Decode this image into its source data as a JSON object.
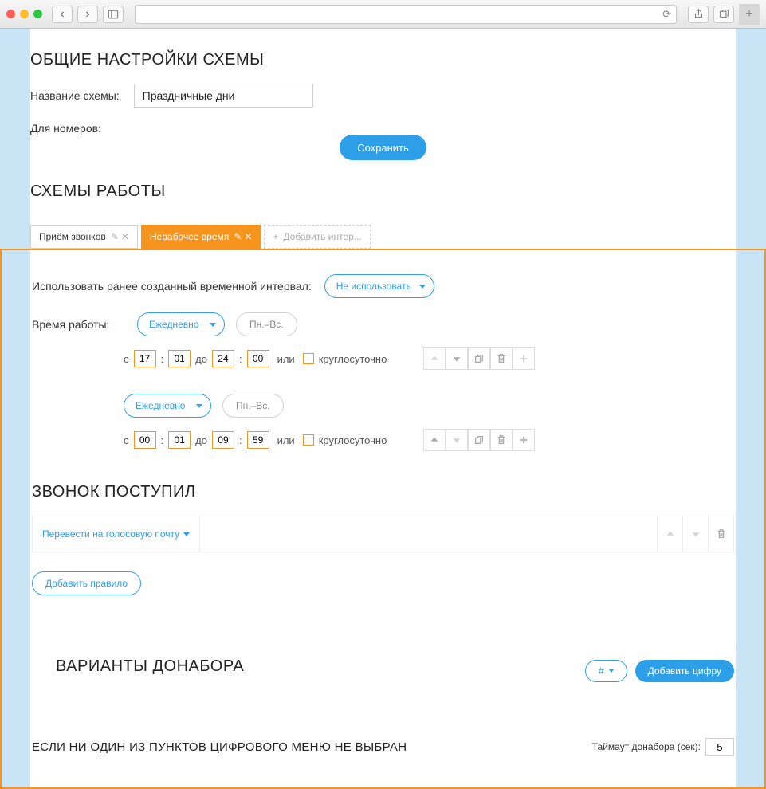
{
  "browser": {},
  "general": {
    "heading": "ОБЩИЕ НАСТРОЙКИ СХЕМЫ",
    "name_label": "Название схемы:",
    "name_value": "Праздничные дни",
    "numbers_label": "Для номеров:",
    "save": "Сохранить"
  },
  "schemes": {
    "heading": "СХЕМЫ РАБОТЫ",
    "tabs": [
      {
        "label": "Приём звонков"
      },
      {
        "label": "Нерабочее время"
      },
      {
        "label": "Добавить интер..."
      }
    ]
  },
  "work": {
    "interval_label": "Использовать ранее созданный временной интервал:",
    "interval_select": "Не использовать",
    "time_label": "Время работы:",
    "freq": "Ежедневно",
    "days": "Пн.–Вс.",
    "from": "с",
    "sep": ":",
    "to": "до",
    "or": "или",
    "allday": "круглосуточно",
    "rows": [
      {
        "h1": "17",
        "m1": "01",
        "h2": "24",
        "m2": "00"
      },
      {
        "h1": "00",
        "m1": "01",
        "h2": "09",
        "m2": "59"
      }
    ]
  },
  "call": {
    "heading": "ЗВОНОК ПОСТУПИЛ",
    "rule_select": "Перевести на голосовую почту",
    "add_rule": "Добавить правило"
  },
  "dial": {
    "heading": "ВАРИАНТЫ ДОНАБОРА",
    "hash": "#",
    "add": "Добавить цифру"
  },
  "fallback": {
    "heading": "ЕСЛИ НИ ОДИН ИЗ ПУНКТОВ ЦИФРОВОГО МЕНЮ НЕ ВЫБРАН",
    "timeout_label": "Таймаут донабора (сек):",
    "timeout_value": "5"
  }
}
